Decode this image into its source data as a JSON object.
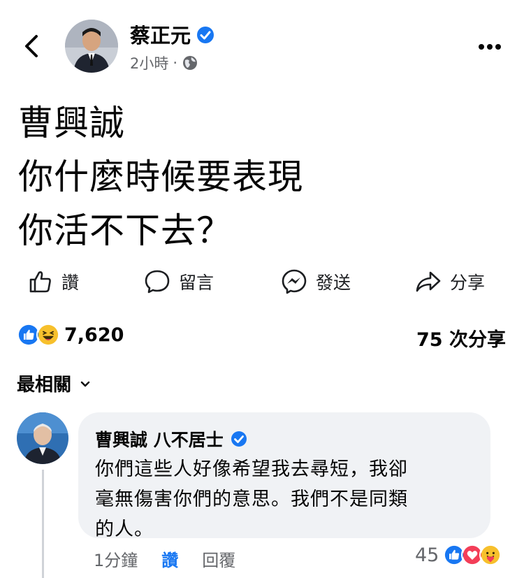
{
  "header": {
    "author": "蔡正元",
    "timestamp": "2小時",
    "separator": "·",
    "back_icon": "chevron-left-icon",
    "more_icon": "more-horizontal-icon",
    "privacy_icon": "globe-icon"
  },
  "post": {
    "text": "曹興誠\n你什麼時候要表現\n你活不下去？"
  },
  "actions": [
    {
      "label": "讚",
      "icon": "thumbs-up-icon"
    },
    {
      "label": "留言",
      "icon": "comment-icon"
    },
    {
      "label": "發送",
      "icon": "messenger-icon"
    },
    {
      "label": "分享",
      "icon": "share-icon"
    }
  ],
  "stats": {
    "reaction_count": "7,620",
    "share_count": "75 次分享",
    "reaction_icons": [
      "like-icon",
      "haha-icon"
    ]
  },
  "comments_sort": {
    "label": "最相關"
  },
  "comment": {
    "author": "曹興誠  八不居士",
    "text": "你們這些人好像希望我去尋短，我卻\n毫無傷害你們的意思。我們不是同類\n的人。",
    "time": "1分鐘",
    "like_label": "讚",
    "reply_label": "回覆",
    "reaction_count": "45",
    "reaction_icons": [
      "like-icon",
      "love-icon",
      "care-icon"
    ]
  },
  "colors": {
    "accent": "#1877f2",
    "muted": "#65676b",
    "bubble": "#f0f2f5"
  }
}
